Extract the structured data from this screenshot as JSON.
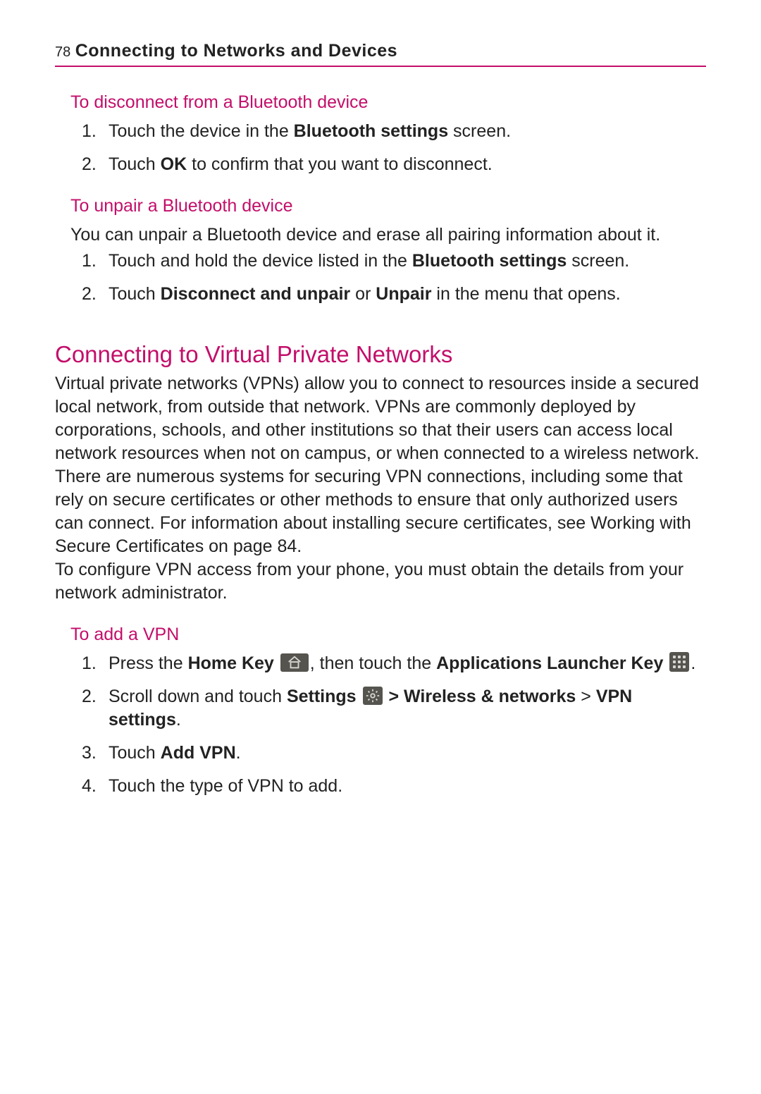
{
  "header": {
    "page_number": "78",
    "chapter_title": "Connecting to Networks and Devices"
  },
  "section_disconnect": {
    "heading": "To disconnect from a Bluetooth device",
    "step1_a": "Touch the device in the ",
    "step1_b": "Bluetooth settings",
    "step1_c": " screen.",
    "step2_a": "Touch ",
    "step2_b": "OK",
    "step2_c": " to confirm that you want to disconnect."
  },
  "section_unpair": {
    "heading": "To unpair a Bluetooth device",
    "intro": "You can unpair a Bluetooth device and erase all pairing information about it.",
    "step1_a": "Touch and hold the device listed in the ",
    "step1_b": "Bluetooth settings",
    "step1_c": " screen.",
    "step2_a": "Touch ",
    "step2_b": "Disconnect and unpair",
    "step2_c": " or ",
    "step2_d": "Unpair",
    "step2_e": " in the menu that opens."
  },
  "section_vpn": {
    "title": "Connecting to Virtual Private Networks",
    "para1": "Virtual private networks (VPNs) allow you to connect to resources inside a secured local network, from outside that network. VPNs are commonly deployed by corporations, schools, and other institutions so that their users can access local network resources when not on campus, or when connected to a wireless network.",
    "para2": "There are numerous systems for securing VPN connections, including some that rely on secure certificates or other methods to ensure that only authorized users can connect. For information about installing secure certificates, see Working with Secure Certificates on page 84.",
    "para3": "To configure VPN access from your phone, you must obtain the details from your network administrator."
  },
  "section_add_vpn": {
    "heading": "To add a VPN",
    "step1_a": "Press the ",
    "step1_b": "Home Key",
    "step1_c": ", then touch the ",
    "step1_d": "Applications Launcher Key",
    "step1_e": ".",
    "step2_a": "Scroll down and touch ",
    "step2_b": "Settings",
    "step2_c": " > ",
    "step2_d": "Wireless & networks",
    "step2_e": " > ",
    "step2_f": "VPN settings",
    "step2_g": ".",
    "step3_a": "Touch ",
    "step3_b": "Add VPN",
    "step3_c": ".",
    "step4": "Touch the type of VPN to add."
  }
}
